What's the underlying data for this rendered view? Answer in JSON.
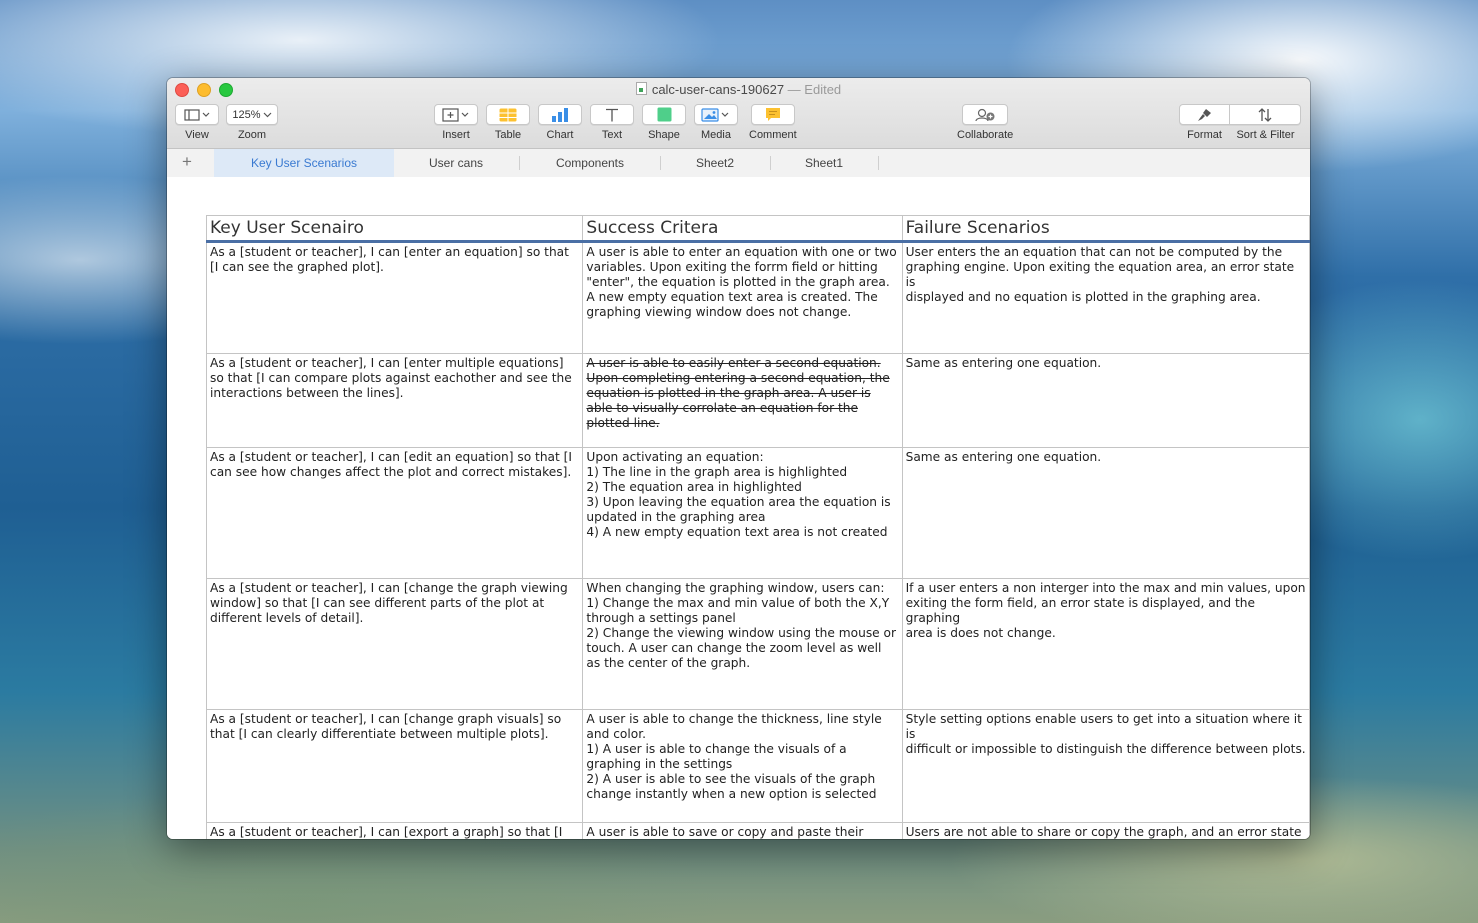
{
  "window": {
    "title": "calc-user-cans-190627",
    "title_separator": "—",
    "status": "Edited"
  },
  "toolbar": {
    "view_label": "View",
    "zoom_value": "125%",
    "zoom_label": "Zoom",
    "insert_label": "Insert",
    "table_label": "Table",
    "chart_label": "Chart",
    "text_label": "Text",
    "shape_label": "Shape",
    "media_label": "Media",
    "comment_label": "Comment",
    "collaborate_label": "Collaborate",
    "format_label": "Format",
    "sort_filter_label": "Sort & Filter"
  },
  "tabs": [
    {
      "label": "Key User Scenarios",
      "active": true
    },
    {
      "label": "User cans"
    },
    {
      "label": "Components"
    },
    {
      "label": "Sheet2"
    },
    {
      "label": "Sheet1"
    }
  ],
  "table": {
    "headers": [
      "Key User Scenairo",
      "Success Critera",
      "Failure Scenarios"
    ],
    "rows": [
      {
        "scenario": "As a [student or teacher], I can [enter an equation] so that [I can see the graphed plot].",
        "success": [
          "A user is able to enter an equation with one or two variables. Upon exiting the forrm field or hitting \"enter\", the equation is plotted in the graph area. A new empty equation text area is created. The graphing viewing window does not change."
        ],
        "failure": [
          "User enters the an equation that can not be computed by the",
          "graphing engine. Upon exiting the equation area, an error state is",
          "displayed and no equation is plotted in the graphing area."
        ]
      },
      {
        "scenario": "As a [student or teacher], I can [enter multiple equations] so that [I can compare plots against eachother and see the interactions between the lines].",
        "success": [
          "A user is able to easily enter a second equation. Upon completing entering a second equation, the equation is plotted in the graph area. A user is able to visually corrolate an equation for the plotted line."
        ],
        "success_strikethrough": true,
        "failure": [
          "Same as entering one equation."
        ]
      },
      {
        "scenario": "As a [student or teacher], I can [edit an equation] so that [I can see how changes affect the plot and correct mistakes].",
        "success": [
          "Upon activating an equation:",
          "1) The line in the graph area  is highlighted",
          "2) The equation area in highlighted",
          "3) Upon leaving the equation area the equation is updated in the graphing area",
          "4) A new empty equation text area is not created"
        ],
        "failure": [
          "Same as entering one equation."
        ]
      },
      {
        "scenario": "As a [student or teacher], I can [change the graph viewing window] so that [I can see different parts of the plot at different levels of detail].",
        "success": [
          "When changing the graphing window, users can:",
          "1) Change the max and min value of both the X,Y through a settings panel",
          "2) Change the viewing window using the mouse or touch. A user can change the zoom level as well as the center of the graph."
        ],
        "failure": [
          "If a user enters a non interger into the max and min values, upon",
          "exiting the form field, an error state is displayed, and the graphing",
          "area is does not change."
        ]
      },
      {
        "scenario": "As a [student or teacher], I can [change graph visuals] so that [I can clearly differentiate between multiple plots].",
        "success": [
          "A user is able to change the thickness, line style and color.",
          "1) A user is able to change the visuals of a graphing in the settings",
          "2) A user is able to see the visuals of the graph change instantly when a new option is selected"
        ],
        "failure": [
          "Style setting options enable users to get into a situation where it is",
          "difficult or impossible to distinguish the difference between plots."
        ]
      },
      {
        "scenario": "As a [student or teacher], I can [export a graph] so that [I",
        "success": [
          "A user is able to save or copy and paste  their graph"
        ],
        "failure": [
          "Users are not able to share or copy the graph, and an error state"
        ]
      }
    ]
  }
}
